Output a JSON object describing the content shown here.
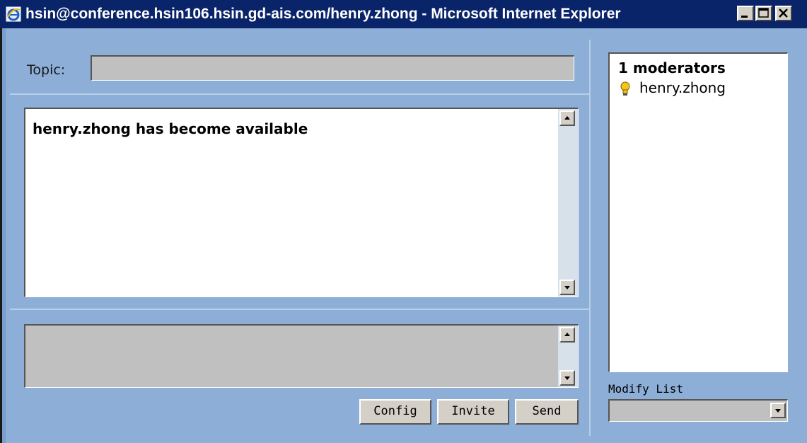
{
  "window": {
    "title": "hsin@conference.hsin106.hsin.gd-ais.com/henry.zhong - Microsoft Internet Explorer",
    "icon": "internet-explorer-icon"
  },
  "topic": {
    "label": "Topic:",
    "value": ""
  },
  "log": {
    "messages": [
      {
        "text": "henry.zhong has become available"
      }
    ]
  },
  "compose": {
    "value": ""
  },
  "buttons": {
    "config": "Config",
    "invite": "Invite",
    "send": "Send"
  },
  "roster": {
    "heading": "1 moderators",
    "members": [
      {
        "name": "henry.zhong",
        "icon": "lightbulb-icon"
      }
    ]
  },
  "modify_list": {
    "label": "Modify List",
    "selected": ""
  },
  "colors": {
    "titlebar": "#0a246a",
    "frame": "#8caed7",
    "field_gray": "#c0c0c0"
  }
}
